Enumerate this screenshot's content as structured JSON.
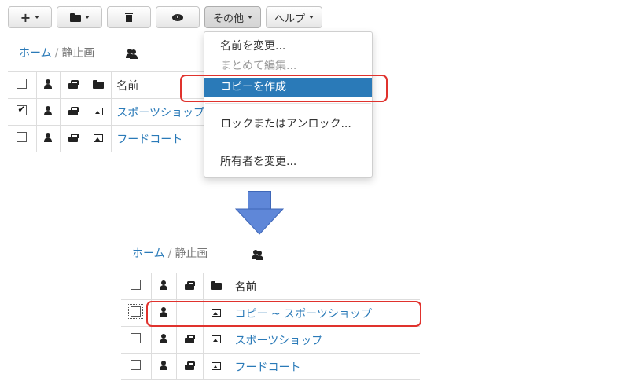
{
  "toolbar": {
    "add_icon": "plus-icon",
    "folder_icon": "folder-icon",
    "delete_icon": "trash-icon",
    "view_icon": "eye-icon",
    "other_label": "その他",
    "help_label": "ヘルプ"
  },
  "dropdown": {
    "items": [
      {
        "label": "名前を変更...",
        "state": "enabled"
      },
      {
        "label": "まとめて編集...",
        "state": "disabled"
      },
      {
        "label": "コピーを作成",
        "state": "selected"
      },
      {
        "label": "ロックまたはアンロック...",
        "state": "enabled"
      },
      {
        "label": "所有者を変更...",
        "state": "enabled"
      }
    ]
  },
  "top_panel": {
    "breadcrumb": {
      "home": "ホーム",
      "separator": "/",
      "current": "静止画"
    },
    "table": {
      "name_header": "名前",
      "rows": [
        {
          "checked": true,
          "name": "スポーツショップ"
        },
        {
          "checked": false,
          "name": "フードコート"
        }
      ]
    }
  },
  "bottom_panel": {
    "breadcrumb": {
      "home": "ホーム",
      "separator": "/",
      "current": "静止画"
    },
    "table": {
      "name_header": "名前",
      "rows": [
        {
          "checked": false,
          "locked": false,
          "name": "コピー ~ スポーツショップ"
        },
        {
          "checked": false,
          "locked": true,
          "name": "スポーツショップ"
        },
        {
          "checked": false,
          "locked": true,
          "name": "フードコート"
        }
      ]
    }
  },
  "colors": {
    "link": "#2a7ab8",
    "selected_bg": "#2a7ab8",
    "highlight": "#e0322d",
    "arrow": "#5f87d8"
  }
}
